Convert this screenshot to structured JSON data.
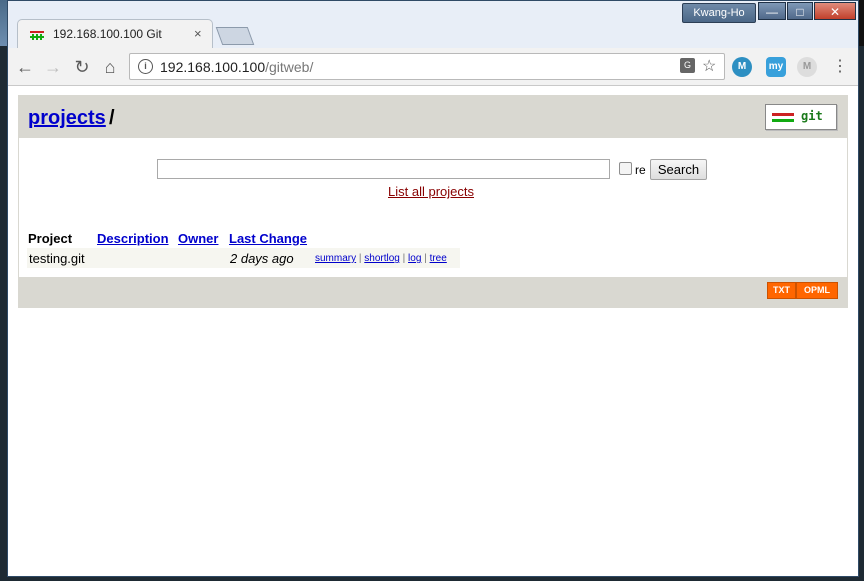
{
  "browser": {
    "profile_name": "Kwang-Ho",
    "tab": {
      "title": "192.168.100.100 Git",
      "close": "×"
    },
    "url": {
      "host": "192.168.100.100",
      "path": "/gitweb/"
    },
    "window_controls": {
      "minimize": "—",
      "maximize": "□",
      "close": "✕"
    }
  },
  "page": {
    "breadcrumb": {
      "link": "projects",
      "separator": "/"
    },
    "logo_text": "git",
    "search": {
      "value": "",
      "regex_label": "re",
      "button": "Search"
    },
    "list_all_link": "List all projects",
    "table": {
      "headers": [
        "Project",
        "Description",
        "Owner",
        "Last Change"
      ],
      "rows": [
        {
          "project": "testing.git",
          "description": "",
          "owner": "",
          "last_change": "2 days ago",
          "actions": [
            "summary",
            "shortlog",
            "log",
            "tree"
          ]
        }
      ]
    },
    "feeds": [
      "TXT",
      "OPML"
    ]
  },
  "colors": {
    "header_bg": "#d9d8d1",
    "link": "#0000cc",
    "list_all": "#880000",
    "feed": "#ff6600"
  }
}
